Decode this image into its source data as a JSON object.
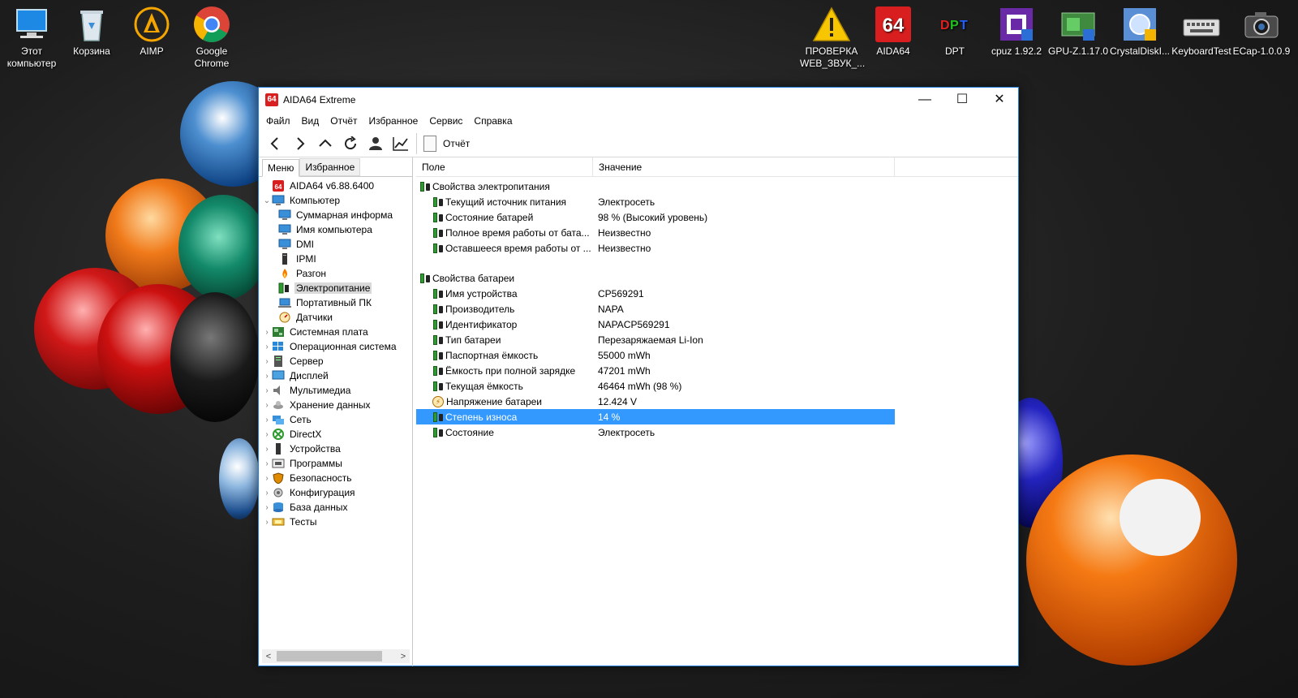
{
  "desktop": {
    "icons_left": [
      {
        "label": "Этот компьютер",
        "icon": "computer-icon"
      },
      {
        "label": "Корзина",
        "icon": "recycle-bin-icon"
      },
      {
        "label": "AIMP",
        "icon": "aimp-icon"
      },
      {
        "label": "Google Chrome",
        "icon": "chrome-icon"
      }
    ],
    "icons_right": [
      {
        "label": "ПРОВЕРКА WEB_ЗВУК_...",
        "icon": "warning-icon"
      },
      {
        "label": "AIDA64",
        "icon": "aida64-icon"
      },
      {
        "label": "DPT",
        "icon": "dpt-icon"
      },
      {
        "label": "cpuz 1.92.2",
        "icon": "cpuz-icon"
      },
      {
        "label": "GPU-Z.1.17.0",
        "icon": "gpuz-icon"
      },
      {
        "label": "CrystalDiskI...",
        "icon": "crystaldisk-icon"
      },
      {
        "label": "KeyboardTest",
        "icon": "keyboard-icon"
      },
      {
        "label": "ECap-1.0.0.9",
        "icon": "camera-icon"
      }
    ]
  },
  "window": {
    "title": "AIDA64 Extreme",
    "app_icon_text": "64",
    "controls": {
      "minimize": "—",
      "maximize": "☐",
      "close": "✕"
    }
  },
  "menu": [
    "Файл",
    "Вид",
    "Отчёт",
    "Избранное",
    "Сервис",
    "Справка"
  ],
  "toolbar": {
    "buttons": [
      "back-icon",
      "forward-icon",
      "up-icon",
      "refresh-icon",
      "user-icon",
      "chart-icon"
    ],
    "report_label": "Отчёт"
  },
  "left_panel": {
    "tabs": [
      "Меню",
      "Избранное"
    ],
    "active_tab": "Меню",
    "tree": [
      {
        "label": "AIDA64 v6.88.6400",
        "level": 0,
        "expander": "",
        "icon": "aida64-small-icon"
      },
      {
        "label": "Компьютер",
        "level": 0,
        "expander": "v",
        "icon": "monitor-icon"
      },
      {
        "label": "Суммарная информа",
        "level": 1,
        "expander": "",
        "icon": "monitor-icon"
      },
      {
        "label": "Имя компьютера",
        "level": 1,
        "expander": "",
        "icon": "monitor-icon"
      },
      {
        "label": "DMI",
        "level": 1,
        "expander": "",
        "icon": "monitor-icon"
      },
      {
        "label": "IPMI",
        "level": 1,
        "expander": "",
        "icon": "tower-icon"
      },
      {
        "label": "Разгон",
        "level": 1,
        "expander": "",
        "icon": "flame-icon"
      },
      {
        "label": "Электропитание",
        "level": 1,
        "expander": "",
        "icon": "battery-plug-icon",
        "selected": true
      },
      {
        "label": "Портативный ПК",
        "level": 1,
        "expander": "",
        "icon": "laptop-icon"
      },
      {
        "label": "Датчики",
        "level": 1,
        "expander": "",
        "icon": "gauge-icon"
      },
      {
        "label": "Системная плата",
        "level": 0,
        "expander": ">",
        "icon": "motherboard-icon"
      },
      {
        "label": "Операционная система",
        "level": 0,
        "expander": ">",
        "icon": "windows-icon"
      },
      {
        "label": "Сервер",
        "level": 0,
        "expander": ">",
        "icon": "server-icon"
      },
      {
        "label": "Дисплей",
        "level": 0,
        "expander": ">",
        "icon": "display-icon"
      },
      {
        "label": "Мультимедиа",
        "level": 0,
        "expander": ">",
        "icon": "speaker-icon"
      },
      {
        "label": "Хранение данных",
        "level": 0,
        "expander": ">",
        "icon": "storage-icon"
      },
      {
        "label": "Сеть",
        "level": 0,
        "expander": ">",
        "icon": "network-icon"
      },
      {
        "label": "DirectX",
        "level": 0,
        "expander": ">",
        "icon": "directx-icon"
      },
      {
        "label": "Устройства",
        "level": 0,
        "expander": ">",
        "icon": "device-icon"
      },
      {
        "label": "Программы",
        "level": 0,
        "expander": ">",
        "icon": "programs-icon"
      },
      {
        "label": "Безопасность",
        "level": 0,
        "expander": ">",
        "icon": "shield-icon"
      },
      {
        "label": "Конфигурация",
        "level": 0,
        "expander": ">",
        "icon": "config-icon"
      },
      {
        "label": "База данных",
        "level": 0,
        "expander": ">",
        "icon": "database-icon"
      },
      {
        "label": "Тесты",
        "level": 0,
        "expander": ">",
        "icon": "tests-icon"
      }
    ]
  },
  "right_panel": {
    "columns": [
      "Поле",
      "Значение"
    ],
    "sections": [
      {
        "title": "Свойства электропитания",
        "rows": [
          {
            "field": "Текущий источник питания",
            "value": "Электросеть",
            "icon": "battery-plug-icon"
          },
          {
            "field": "Состояние батарей",
            "value": "98 % (Высокий уровень)",
            "icon": "battery-plug-icon"
          },
          {
            "field": "Полное время работы от бата...",
            "value": "Неизвестно",
            "icon": "battery-plug-icon"
          },
          {
            "field": "Оставшееся время работы от ...",
            "value": "Неизвестно",
            "icon": "battery-plug-icon"
          }
        ]
      },
      {
        "title": "Свойства батареи",
        "rows": [
          {
            "field": "Имя устройства",
            "value": "CP569291",
            "icon": "battery-plug-icon"
          },
          {
            "field": "Производитель",
            "value": "NAPA",
            "icon": "battery-plug-icon"
          },
          {
            "field": "Идентификатор",
            "value": "NAPACP569291",
            "icon": "battery-plug-icon"
          },
          {
            "field": "Тип батареи",
            "value": "Перезаряжаемая Li-Ion",
            "icon": "battery-plug-icon"
          },
          {
            "field": "Паспортная ёмкость",
            "value": "55000 mWh",
            "icon": "battery-plug-icon"
          },
          {
            "field": "Ёмкость при полной зарядке",
            "value": "47201 mWh",
            "icon": "battery-plug-icon"
          },
          {
            "field": "Текущая ёмкость",
            "value": "46464 mWh  (98 %)",
            "icon": "battery-plug-icon"
          },
          {
            "field": "Напряжение батареи",
            "value": "12.424 V",
            "icon": "voltage-icon"
          },
          {
            "field": "Степень износа",
            "value": "14 %",
            "icon": "battery-plug-icon",
            "selected": true
          },
          {
            "field": "Состояние",
            "value": "Электросеть",
            "icon": "battery-plug-icon"
          }
        ]
      }
    ]
  },
  "colors": {
    "selection": "#3399ff",
    "window_border": "#1f7cd8",
    "battery_green": "#2f9a2f"
  }
}
